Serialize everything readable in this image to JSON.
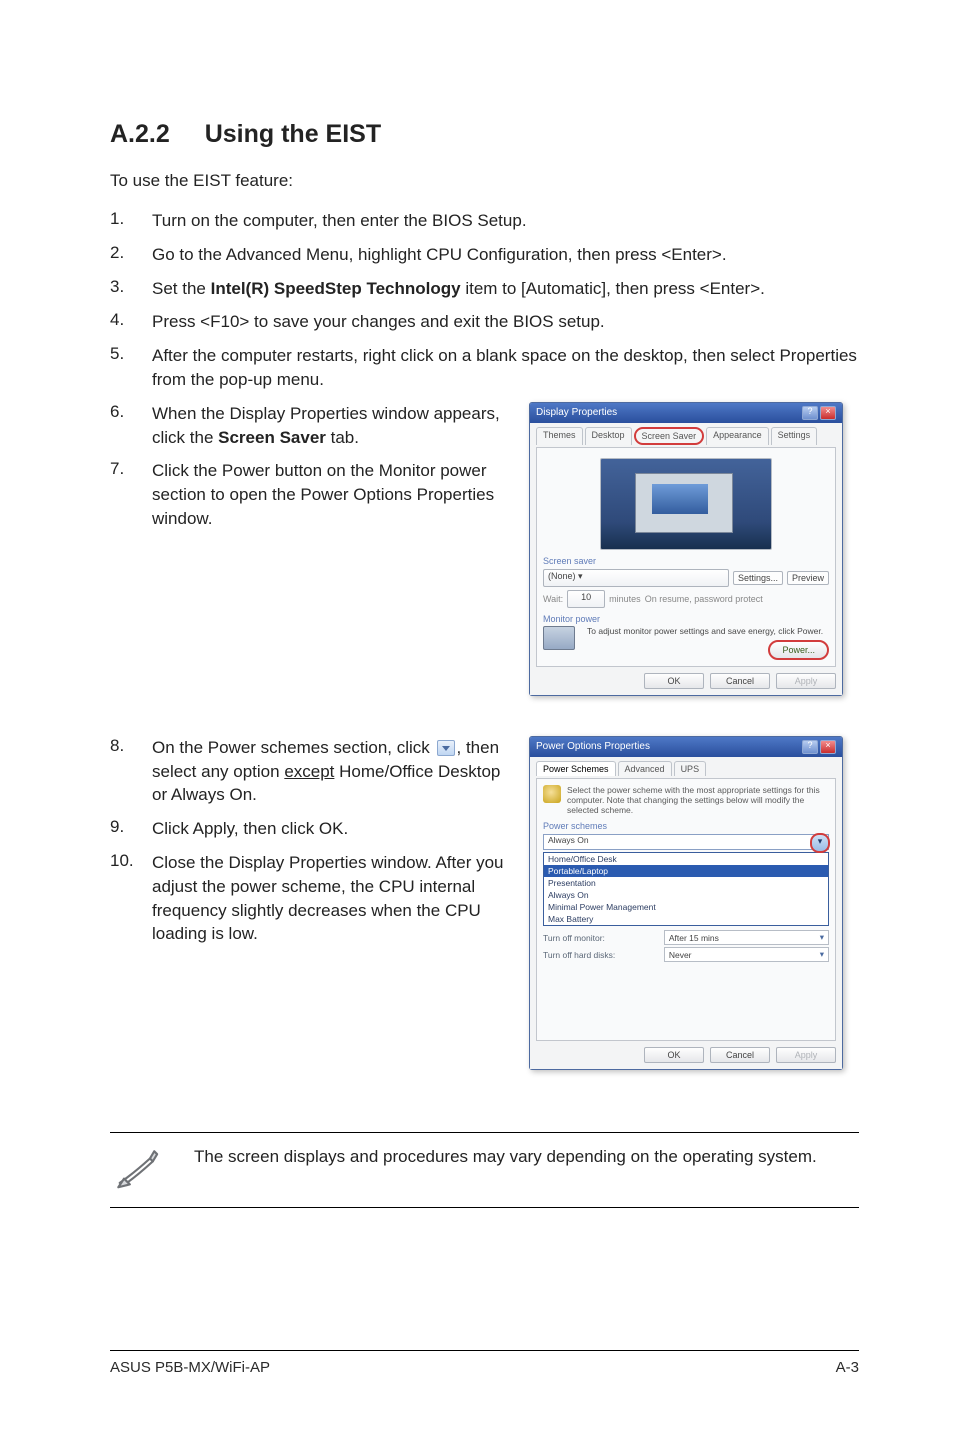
{
  "title": {
    "num": "A.2.2",
    "text": "Using the EIST"
  },
  "lead": "To use the EIST feature:",
  "steps_a": [
    {
      "n": "1.",
      "html": "Turn on the computer, then enter the BIOS Setup."
    },
    {
      "n": "2.",
      "html": "Go to the Advanced Menu, highlight CPU Configuration, then press <Enter>."
    },
    {
      "n": "3.",
      "html": "Set the <b>Intel(R) SpeedStep Technology</b> item to [Automatic], then press <Enter>."
    },
    {
      "n": "4.",
      "html": "Press <F10> to save your changes and exit the BIOS setup."
    },
    {
      "n": "5.",
      "html": "After the computer restarts, right click on a blank space on the desktop, then select Properties from the pop-up menu."
    }
  ],
  "steps_b": [
    {
      "n": "6.",
      "html": "When the Display Properties window appears, click the <b>Screen Saver</b> tab."
    },
    {
      "n": "7.",
      "html": "Click the Power button on the Monitor power section to open the Power Options Properties window."
    }
  ],
  "steps_c": [
    {
      "n": "8.",
      "html": "On the Power schemes section, click {{chev}}, then select any option <u>except</u> Home/Office Desktop or Always On."
    },
    {
      "n": "9.",
      "html": "Click Apply, then click OK."
    },
    {
      "n": "10.",
      "html": "Close the Display Properties window. After you adjust the power scheme, the CPU internal frequency slightly decreases when the CPU loading is low."
    }
  ],
  "display_dialog": {
    "title": "Display Properties",
    "tabs": [
      "Themes",
      "Desktop",
      "Screen Saver",
      "Appearance",
      "Settings"
    ],
    "active_tab": "Screen Saver",
    "group_ss": "Screen saver",
    "ss_value": "(None)",
    "btn_settings": "Settings...",
    "btn_preview": "Preview",
    "wait_text": "Wait:",
    "wait_val": "10",
    "wait_min": "minutes",
    "resume_chk": "On resume, password protect",
    "group_mp": "Monitor power",
    "mp_text": "To adjust monitor power settings and save energy, click Power.",
    "btn_power": "Power...",
    "btn_ok": "OK",
    "btn_cancel": "Cancel",
    "btn_apply": "Apply"
  },
  "power_dialog": {
    "title": "Power Options Properties",
    "tabs": [
      "Power Schemes",
      "Advanced",
      "UPS"
    ],
    "active_tab": "Power Schemes",
    "desc": "Select the power scheme with the most appropriate settings for this computer. Note that changing the settings below will modify the selected scheme.",
    "group_ps": "Power schemes",
    "selected": "Portable/Laptop",
    "options": [
      "Always On",
      "Home/Office Desk",
      "Portable/Laptop",
      "Presentation",
      "Always On",
      "Minimal Power Management",
      "Max Battery"
    ],
    "row_monitor_label": "Turn off monitor:",
    "row_monitor_val": "After 15 mins",
    "row_hdd_label": "Turn off hard disks:",
    "row_hdd_val": "Never",
    "btn_ok": "OK",
    "btn_cancel": "Cancel",
    "btn_apply": "Apply"
  },
  "note": "The screen displays and procedures may vary depending on the operating system.",
  "footer_left": "ASUS P5B-MX/WiFi-AP",
  "footer_right": "A-3"
}
